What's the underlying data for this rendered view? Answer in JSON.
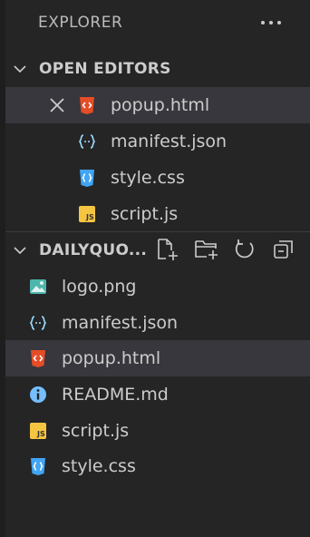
{
  "explorer": {
    "title": "EXPLORER"
  },
  "open_editors": {
    "label": "OPEN EDITORS",
    "items": [
      {
        "name": "popup.html",
        "icon": "html-file-icon"
      },
      {
        "name": "manifest.json",
        "icon": "json-file-icon"
      },
      {
        "name": "style.css",
        "icon": "css-file-icon"
      },
      {
        "name": "script.js",
        "icon": "js-file-icon"
      }
    ]
  },
  "workspace": {
    "label": "DAILYQUO...",
    "actions": [
      "new-file-icon",
      "new-folder-icon",
      "refresh-icon",
      "collapse-all-icon"
    ],
    "files": [
      {
        "name": "logo.png",
        "icon": "image-file-icon"
      },
      {
        "name": "manifest.json",
        "icon": "json-file-icon"
      },
      {
        "name": "popup.html",
        "icon": "html-file-icon"
      },
      {
        "name": "README.md",
        "icon": "info-file-icon"
      },
      {
        "name": "script.js",
        "icon": "js-file-icon"
      },
      {
        "name": "style.css",
        "icon": "css-file-icon"
      }
    ]
  },
  "colors": {
    "background": "#252526",
    "selected_row": "#37373d",
    "html_icon": "#e44d26",
    "css_icon": "#42a5f5",
    "js_icon": "#f5c542",
    "json_icon": "#9cdcfe",
    "info_icon": "#75beff",
    "image_icon": "#4db6ac"
  }
}
